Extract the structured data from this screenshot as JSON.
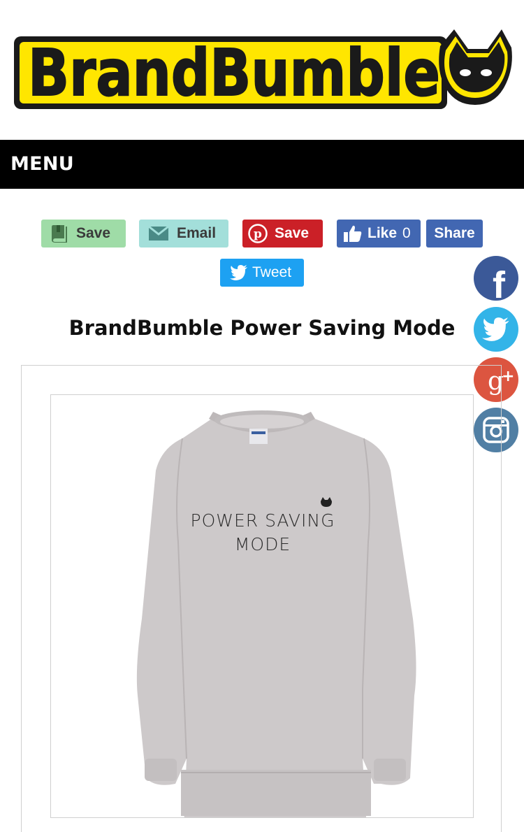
{
  "logo": {
    "text": "BrandBumble"
  },
  "menu": {
    "label": "MENU"
  },
  "share": {
    "bookmark_label": "Save",
    "email_label": "Email",
    "pinterest_label": "Save",
    "like_label": "Like",
    "like_count": "0",
    "fb_share_label": "Share",
    "tweet_label": "Tweet"
  },
  "floating_social": [
    "facebook-icon",
    "twitter-icon",
    "google-plus-icon",
    "instagram-icon"
  ],
  "product": {
    "title": "BrandBumble Power Saving Mode",
    "print_line1": "POWER SAVING",
    "print_line2": "MODE"
  },
  "colors": {
    "logo_yellow": "#ffe600",
    "menu_bg": "#000000",
    "pinterest": "#cb2027",
    "facebook": "#4267b2",
    "twitter": "#1da1f2",
    "bookmark": "#9fdca7",
    "email": "#a3dfda"
  }
}
